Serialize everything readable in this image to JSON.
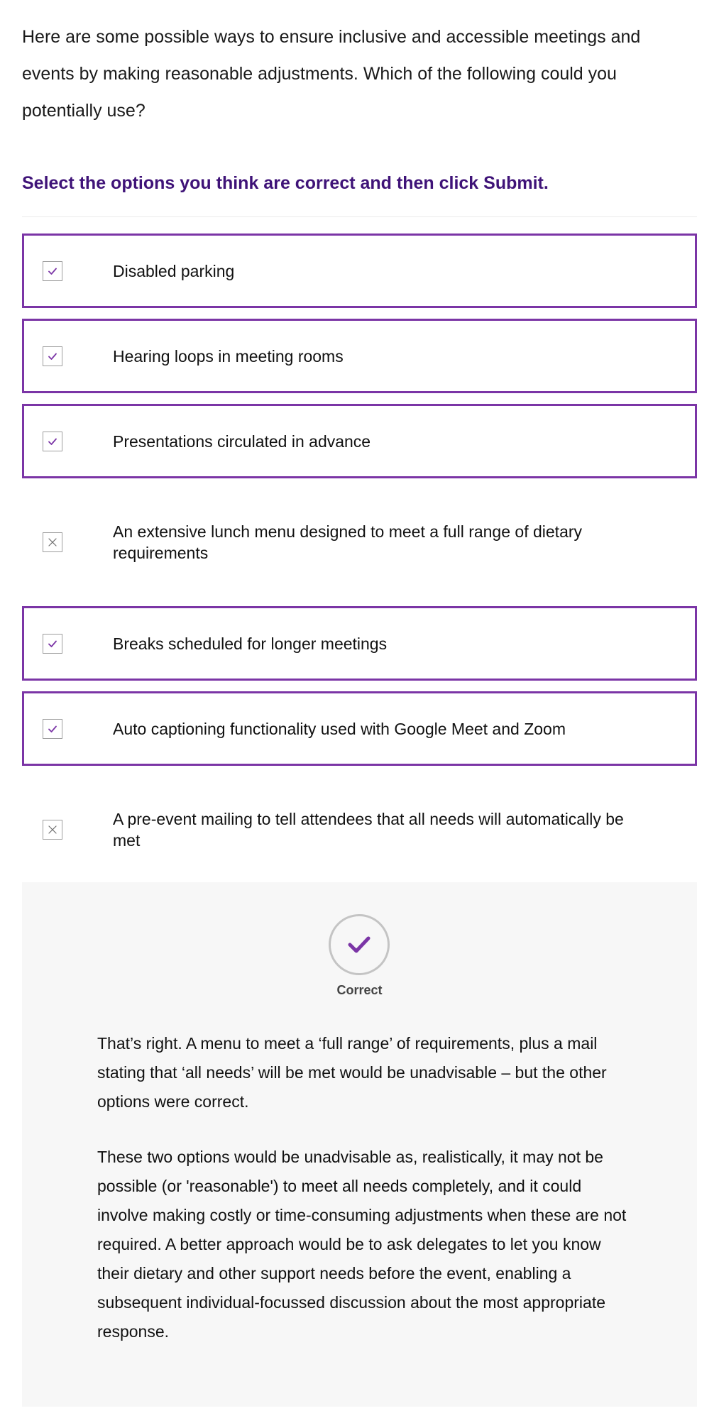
{
  "intro": "Here are some possible ways to ensure inclusive and accessible meetings and events by making reasonable adjustments. Which of the following could you potentially use?",
  "instruction": "Select the options you think are correct and then click Submit.",
  "options": [
    {
      "label": "Disabled parking",
      "state": "correct-selected"
    },
    {
      "label": "Hearing loops in meeting rooms",
      "state": "correct-selected"
    },
    {
      "label": "Presentations circulated in advance",
      "state": "correct-selected"
    },
    {
      "label": "An extensive lunch menu designed to meet a full range of dietary requirements",
      "state": "incorrect-unselected"
    },
    {
      "label": "Breaks scheduled for longer meetings",
      "state": "correct-selected"
    },
    {
      "label": "Auto captioning functionality used with Google Meet and Zoom",
      "state": "correct-selected"
    },
    {
      "label": "A pre-event mailing to tell attendees that all needs will automatically be met",
      "state": "incorrect-unselected"
    }
  ],
  "feedback": {
    "result_icon": "checkmark-icon",
    "result_label": "Correct",
    "paragraphs": [
      "That’s right. A menu to meet a ‘full range’ of requirements, plus a mail stating that ‘all needs’ will be met would be unadvisable – but the other options were correct.",
      "These two options would be unadvisable as, realistically, it may not be possible (or 'reasonable') to meet all needs completely, and it could involve making costly or time-consuming adjustments when these are not required. A better approach would be to ask delegates to let you know their dietary and other support needs before the event, enabling a subsequent individual-focussed discussion about the most appropriate response."
    ]
  },
  "colors": {
    "accent": "#7b35a6",
    "instruction": "#3f1378",
    "feedback_bg": "#f7f7f7"
  }
}
